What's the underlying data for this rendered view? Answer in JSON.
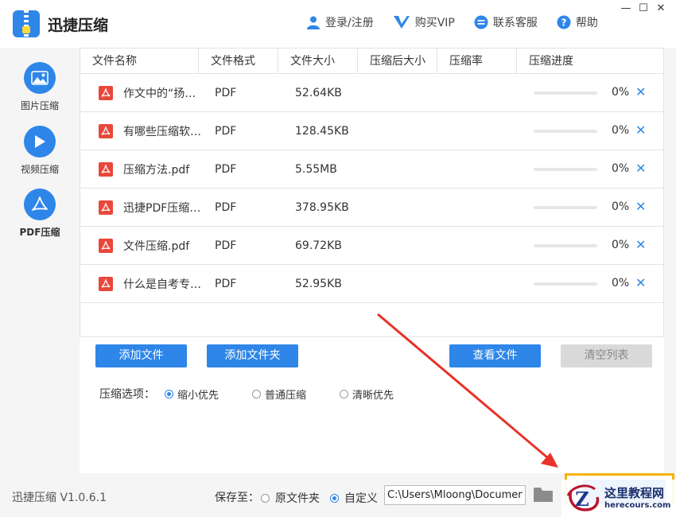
{
  "app": {
    "title": "迅捷压缩"
  },
  "top_actions": [
    {
      "label": "登录/注册",
      "icon": "user-icon"
    },
    {
      "label": "购买VIP",
      "icon": "vip-icon"
    },
    {
      "label": "联系客服",
      "icon": "chat-icon"
    },
    {
      "label": "帮助",
      "icon": "help-icon"
    }
  ],
  "window_controls": {
    "minimize": "—",
    "maximize": "☐",
    "close": "✕"
  },
  "sidebar": {
    "items": [
      {
        "label": "图片压缩",
        "icon": "image-icon",
        "active": false
      },
      {
        "label": "视频压缩",
        "icon": "play-icon",
        "active": false
      },
      {
        "label": "PDF压缩",
        "icon": "pdf-icon",
        "active": true
      }
    ]
  },
  "table": {
    "headers": [
      "文件名称",
      "文件格式",
      "文件大小",
      "压缩后大小",
      "压缩率",
      "压缩进度"
    ],
    "rows": [
      {
        "name": "作文中的“扬…",
        "format": "PDF",
        "size": "52.64KB",
        "compressed": "",
        "ratio": "",
        "progress": 0,
        "progress_label": "0%"
      },
      {
        "name": "有哪些压缩软…",
        "format": "PDF",
        "size": "128.45KB",
        "compressed": "",
        "ratio": "",
        "progress": 0,
        "progress_label": "0%"
      },
      {
        "name": "压缩方法.pdf",
        "format": "PDF",
        "size": "5.55MB",
        "compressed": "",
        "ratio": "",
        "progress": 0,
        "progress_label": "0%"
      },
      {
        "name": "迅捷PDF压缩…",
        "format": "PDF",
        "size": "378.95KB",
        "compressed": "",
        "ratio": "",
        "progress": 0,
        "progress_label": "0%"
      },
      {
        "name": "文件压缩.pdf",
        "format": "PDF",
        "size": "69.72KB",
        "compressed": "",
        "ratio": "",
        "progress": 0,
        "progress_label": "0%"
      },
      {
        "name": "什么是自考专…",
        "format": "PDF",
        "size": "52.95KB",
        "compressed": "",
        "ratio": "",
        "progress": 0,
        "progress_label": "0%"
      }
    ]
  },
  "buttons": {
    "add_files": "添加文件",
    "add_folder": "添加文件夹",
    "view_files": "查看文件",
    "clear_list": "清空列表"
  },
  "options": {
    "label": "压缩选项：",
    "choices": [
      {
        "label": "缩小优先",
        "selected": true
      },
      {
        "label": "普通压缩",
        "selected": false
      },
      {
        "label": "清晰优先",
        "selected": false
      }
    ]
  },
  "footer": {
    "version": "迅捷压缩 V1.0.6.1",
    "save_to_label": "保存至：",
    "save_choices": [
      {
        "label": "原文件夹",
        "selected": false
      },
      {
        "label": "自定义",
        "selected": true
      }
    ],
    "path_value": "C:\\Users\\Mloong\\Documents"
  },
  "watermark": {
    "line1": "这里教程网",
    "line2": "herecours.com"
  },
  "colors": {
    "accent": "#2e86e8",
    "pdf_red": "#e8483a",
    "arrow": "#e8332a",
    "highlight": "#f5b400"
  }
}
